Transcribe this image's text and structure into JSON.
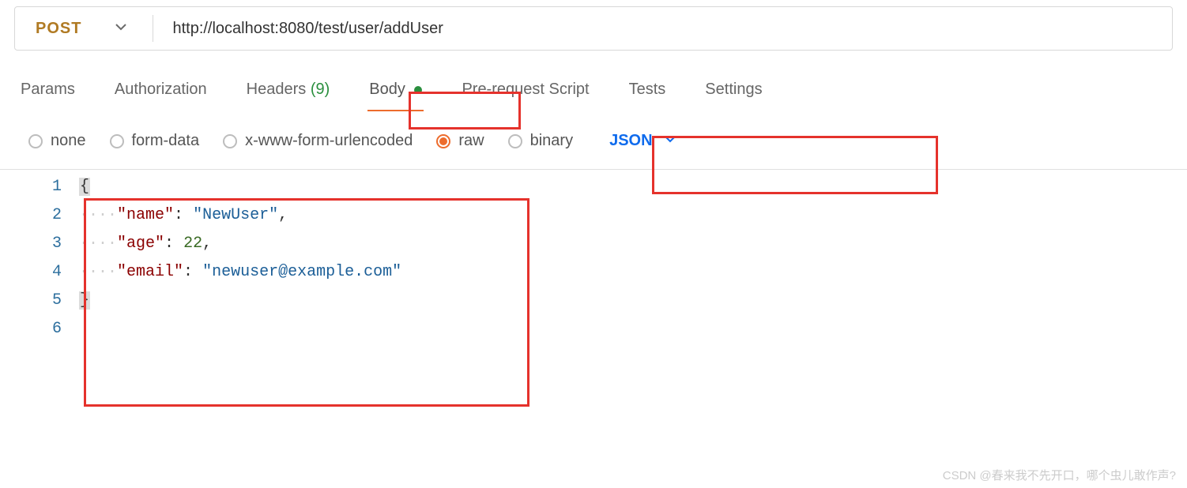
{
  "request": {
    "method": "POST",
    "url": "http://localhost:8080/test/user/addUser"
  },
  "tabs": {
    "params": "Params",
    "authorization": "Authorization",
    "headers_label": "Headers",
    "headers_count": "(9)",
    "body": "Body",
    "prerequest": "Pre-request Script",
    "tests": "Tests",
    "settings": "Settings"
  },
  "body_types": {
    "none": "none",
    "formdata": "form-data",
    "urlencoded": "x-www-form-urlencoded",
    "raw": "raw",
    "binary": "binary",
    "content_type": "JSON"
  },
  "editor": {
    "lines": [
      "1",
      "2",
      "3",
      "4",
      "5",
      "6"
    ],
    "json_body": {
      "name": "NewUser",
      "age": 22,
      "email": "newuser@example.com"
    },
    "tokens": {
      "open": "{",
      "close": "}",
      "k_name": "\"name\"",
      "v_name": "\"NewUser\"",
      "k_age": "\"age\"",
      "v_age": "22",
      "k_email": "\"email\"",
      "v_email": "\"newuser@example.com\"",
      "colon": ":",
      "comma": ","
    }
  },
  "watermark": "CSDN @春来我不先开口，哪个虫儿敢作声?"
}
